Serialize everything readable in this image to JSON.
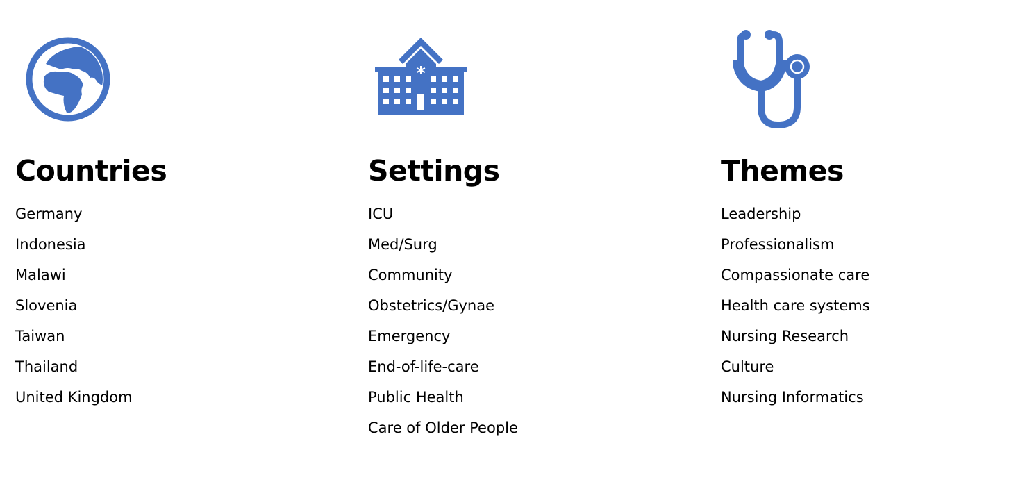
{
  "accent_color": "#4472C4",
  "columns": [
    {
      "icon": "globe-icon",
      "heading": "Countries",
      "items": [
        "Germany",
        "Indonesia",
        "Malawi",
        "Slovenia",
        "Taiwan",
        "Thailand",
        "United Kingdom"
      ]
    },
    {
      "icon": "hospital-icon",
      "heading": "Settings",
      "items": [
        "ICU",
        "Med/Surg",
        "Community",
        "Obstetrics/Gynae",
        "Emergency",
        "End-of-life-care",
        "Public Health",
        "Care of Older People"
      ]
    },
    {
      "icon": "stethoscope-icon",
      "heading": "Themes",
      "items": [
        "Leadership",
        "Professionalism",
        "Compassionate care",
        "Health care systems",
        "Nursing Research",
        "Culture",
        "Nursing Informatics"
      ]
    }
  ]
}
